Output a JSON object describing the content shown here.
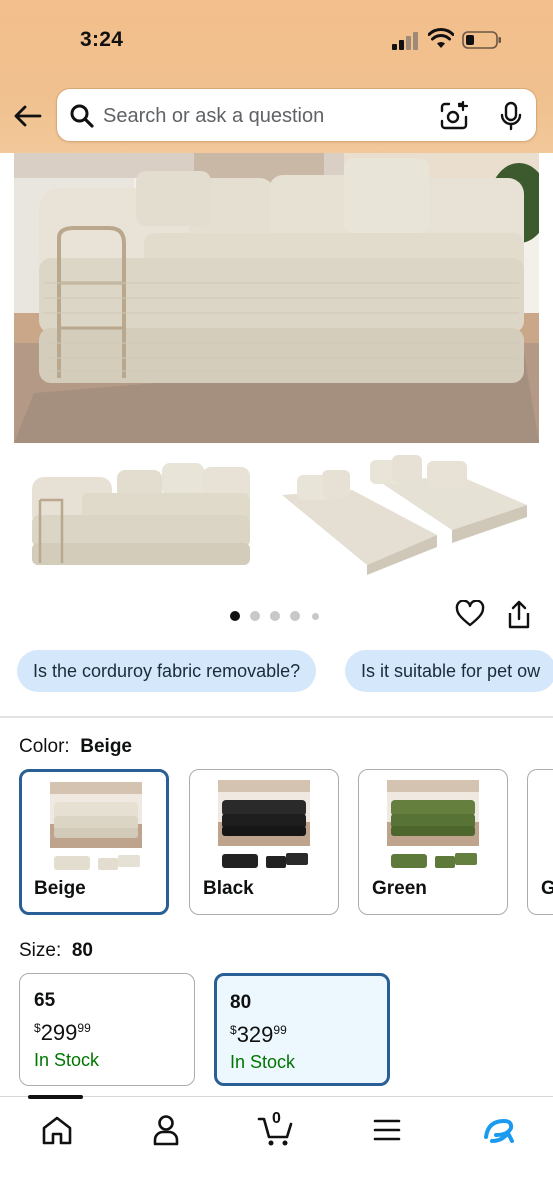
{
  "status_bar": {
    "time": "3:24"
  },
  "search": {
    "placeholder": "Search or ask a question"
  },
  "gallery": {
    "image_count": 5,
    "active_index": 0
  },
  "questions": [
    {
      "text": "Is the corduroy fabric removable?"
    },
    {
      "text": "Is it suitable for pet ow"
    }
  ],
  "color": {
    "heading_label": "Color:",
    "selected": "Beige",
    "options": [
      {
        "name": "Beige",
        "swatch_color": "#e6e0d2",
        "selected": true
      },
      {
        "name": "Black",
        "swatch_color": "#1e1e1e",
        "selected": false
      },
      {
        "name": "Green",
        "swatch_color": "#5a7a3a",
        "selected": false
      },
      {
        "name": "G",
        "swatch_color": "#cccccc",
        "selected": false
      }
    ]
  },
  "size": {
    "heading_label": "Size:",
    "selected": "80",
    "options": [
      {
        "label": "65",
        "currency": "$",
        "price_whole": "299",
        "price_cents": "99",
        "stock": "In Stock",
        "selected": false
      },
      {
        "label": "80",
        "currency": "$",
        "price_whole": "329",
        "price_cents": "99",
        "stock": "In Stock",
        "selected": true
      }
    ]
  },
  "bottom_nav": {
    "cart_count": "0",
    "items": [
      "home-icon",
      "account-icon",
      "cart-icon",
      "menu-icon",
      "rufus-icon"
    ]
  },
  "colors": {
    "header_bg": "#f3bf8c",
    "chip_bg": "#d4e7fb",
    "selected_border": "#2a5f95",
    "in_stock": "#007600",
    "rufus_accent": "#1a9bf0"
  }
}
